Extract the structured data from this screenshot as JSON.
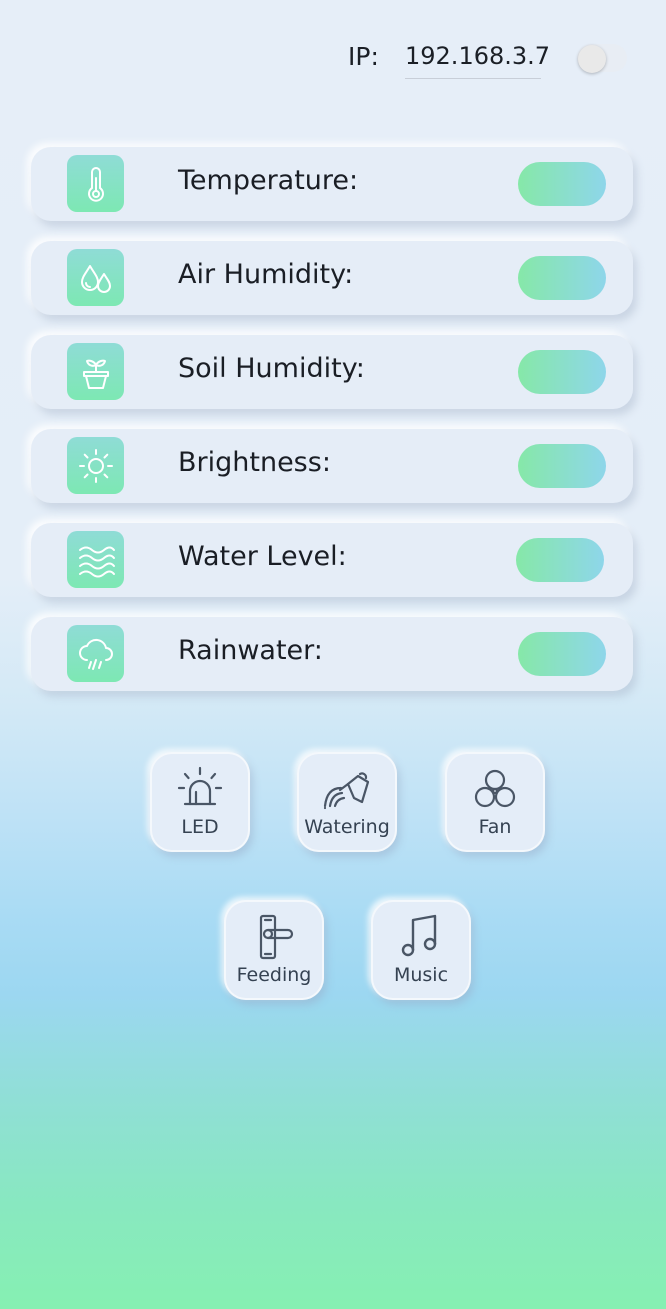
{
  "header": {
    "ip_label": "IP:",
    "ip_value": "192.168.3.7",
    "toggle_on": false
  },
  "sensors": [
    {
      "label": "Temperature:",
      "icon": "thermometer-icon",
      "toggle_on": true
    },
    {
      "label": "Air Humidity:",
      "icon": "water-drops-icon",
      "toggle_on": true
    },
    {
      "label": "Soil Humidity:",
      "icon": "plant-pot-icon",
      "toggle_on": true
    },
    {
      "label": "Brightness:",
      "icon": "sun-icon",
      "toggle_on": true
    },
    {
      "label": "Water Level:",
      "icon": "waves-icon",
      "toggle_on": true
    },
    {
      "label": "Rainwater:",
      "icon": "rain-cloud-icon",
      "toggle_on": true
    }
  ],
  "controls": [
    {
      "label": "LED",
      "icon": "alarm-light-icon"
    },
    {
      "label": "Watering",
      "icon": "watering-can-icon"
    },
    {
      "label": "Fan",
      "icon": "fan-icon"
    },
    {
      "label": "Feeding",
      "icon": "door-handle-icon"
    },
    {
      "label": "Music",
      "icon": "music-note-icon"
    }
  ],
  "colors": {
    "accent_green": "#7de8b3",
    "accent_blue": "#8ed6ea",
    "card_bg": "#e5edf7",
    "icon_stroke": "#4a5666"
  }
}
